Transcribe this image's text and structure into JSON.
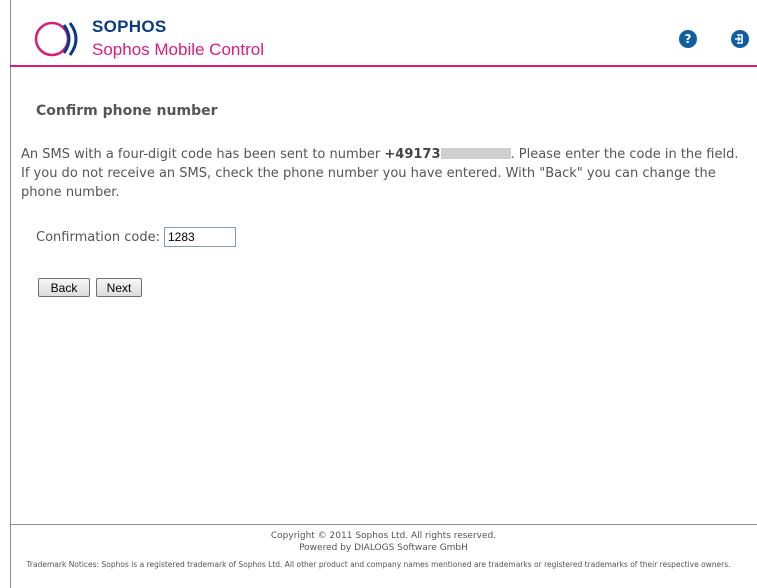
{
  "header": {
    "brand": "SOPHOS",
    "product": "Sophos Mobile Control",
    "help_icon": "question-circle-icon",
    "logout_icon": "logout-arrow-icon",
    "accent_color": "#d81c7d",
    "brand_color": "#0a3a86"
  },
  "page": {
    "title": "Confirm phone number",
    "message_part1": "An SMS with a four-digit code has been sent to number ",
    "phone_prefix": "+49173",
    "message_part2": ". Please enter the code in the field. If you do not receive an SMS, check the phone number you have entered. With \"Back\" you can change the phone number."
  },
  "form": {
    "code_label": "Confirmation code:",
    "code_value": "1283",
    "back_label": "Back",
    "next_label": "Next"
  },
  "footer": {
    "copyright": "Copyright © 2011 Sophos Ltd. All rights reserved.",
    "powered": "Powered by DIALOGS Software GmbH",
    "trademark": "Trademark Notices: Sophos is a registered trademark of Sophos Ltd. All other product and company names mentioned are trademarks or registered trademarks of their respective owners."
  }
}
